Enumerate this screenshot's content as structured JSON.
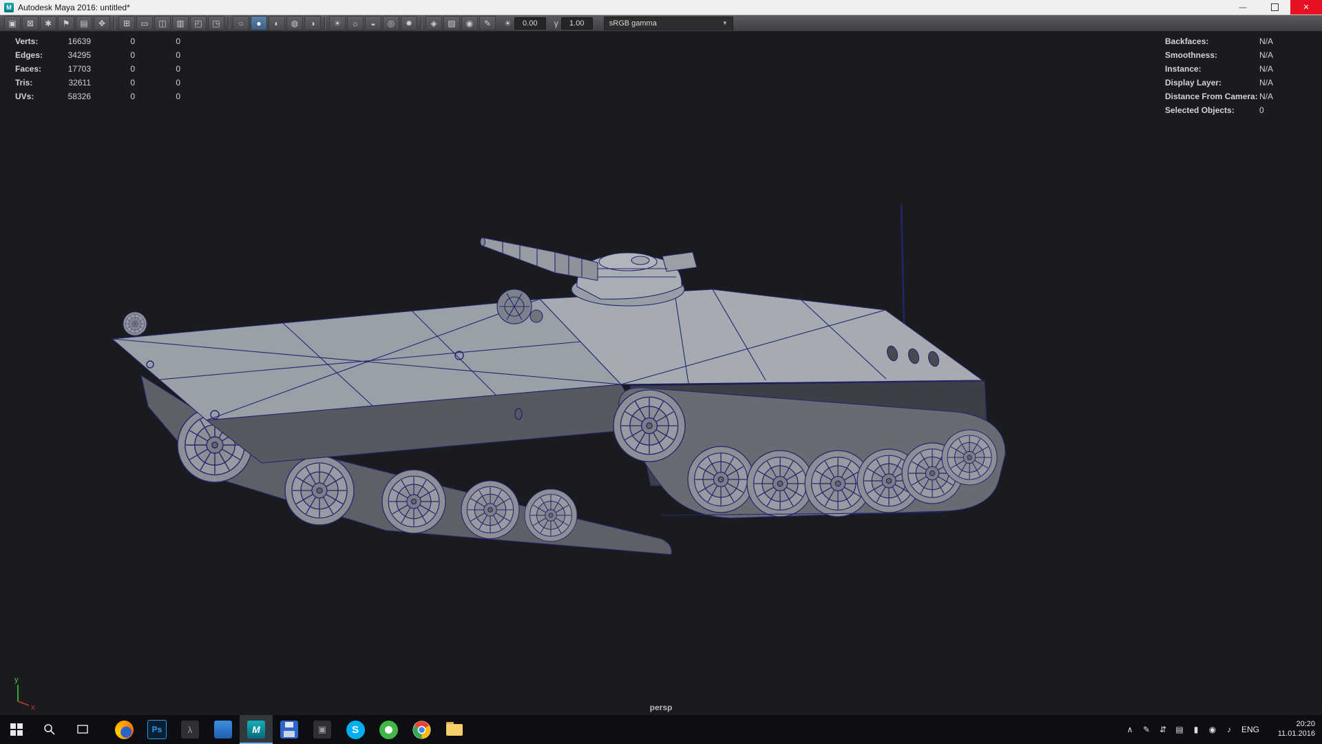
{
  "titlebar": {
    "app_icon_glyph": "M",
    "title": "Autodesk Maya 2016: untitled*",
    "minimize_glyph": "—",
    "close_glyph": "✕"
  },
  "toolbar": {
    "icons": [
      {
        "name": "camera-select",
        "glyph": "▣"
      },
      {
        "name": "camera-lock",
        "glyph": "⊠"
      },
      {
        "name": "camera-attributes",
        "glyph": "✱"
      },
      {
        "name": "bookmark",
        "glyph": "⚑"
      },
      {
        "name": "image-plane",
        "glyph": "▤"
      },
      {
        "name": "pan-zoom",
        "glyph": "✥"
      },
      {
        "name": "grid",
        "glyph": "⊞"
      },
      {
        "name": "film-gate",
        "glyph": "▭"
      },
      {
        "name": "resolution-gate",
        "glyph": "◫"
      },
      {
        "name": "gate-mask",
        "glyph": "▥"
      },
      {
        "name": "field-chart",
        "glyph": "◰"
      },
      {
        "name": "safe-action",
        "glyph": "◳"
      },
      {
        "name": "wireframe",
        "glyph": "○"
      },
      {
        "name": "smooth-shade",
        "glyph": "●"
      },
      {
        "name": "textured",
        "glyph": "◐"
      },
      {
        "name": "use-default-material",
        "glyph": "◍"
      },
      {
        "name": "xray",
        "glyph": "◑"
      },
      {
        "name": "lights",
        "glyph": "☀"
      },
      {
        "name": "shadows",
        "glyph": "☼"
      },
      {
        "name": "ambient-occlusion",
        "glyph": "◒"
      },
      {
        "name": "motion-blur",
        "glyph": "◎"
      },
      {
        "name": "multisample",
        "glyph": "✸"
      },
      {
        "name": "isolate-select",
        "glyph": "◈"
      },
      {
        "name": "fog",
        "glyph": "▨"
      },
      {
        "name": "depth-of-field",
        "glyph": "◉"
      },
      {
        "name": "grease-pencil",
        "glyph": "✎"
      }
    ],
    "exposure_icon": "☀",
    "exposure_value": "0.00",
    "gamma_icon": "γ",
    "gamma_value": "1.00",
    "view_transform": "sRGB gamma",
    "dropdown_arrow": "▼"
  },
  "hud": {
    "left": {
      "rows": [
        {
          "label": "Verts:",
          "c1": "16639",
          "c2": "0",
          "c3": "0"
        },
        {
          "label": "Edges:",
          "c1": "34295",
          "c2": "0",
          "c3": "0"
        },
        {
          "label": "Faces:",
          "c1": "17703",
          "c2": "0",
          "c3": "0"
        },
        {
          "label": "Tris:",
          "c1": "32611",
          "c2": "0",
          "c3": "0"
        },
        {
          "label": "UVs:",
          "c1": "58326",
          "c2": "0",
          "c3": "0"
        }
      ]
    },
    "right": {
      "rows": [
        {
          "label": "Backfaces:",
          "value": "N/A"
        },
        {
          "label": "Smoothness:",
          "value": "N/A"
        },
        {
          "label": "Instance:",
          "value": "N/A"
        },
        {
          "label": "Display Layer:",
          "value": "N/A"
        },
        {
          "label": "Distance From Camera:",
          "value": "N/A"
        },
        {
          "label": "Selected Objects:",
          "value": "0"
        }
      ]
    }
  },
  "viewport": {
    "camera_label": "persp",
    "axis": {
      "x": "x",
      "y": "y"
    }
  },
  "taskbar": {
    "apps": [
      "start",
      "search",
      "task-view",
      "firefox",
      "photoshop",
      "dark-app-1",
      "blue-app",
      "maya",
      "save-app",
      "dark-app-2",
      "skype",
      "green-app",
      "chrome",
      "file-explorer"
    ],
    "active_app": "maya",
    "app_glyphs": {
      "photoshop": "Ps",
      "skype": "S",
      "maya": "M",
      "dark_app_1": "λ",
      "dark_app_2": "▣"
    },
    "tray_icons": [
      {
        "name": "chevron-up",
        "glyph": "∧"
      },
      {
        "name": "pen",
        "glyph": "✎"
      },
      {
        "name": "sync",
        "glyph": "⇵"
      },
      {
        "name": "keyboard",
        "glyph": "▤"
      },
      {
        "name": "battery",
        "glyph": "▮"
      },
      {
        "name": "network",
        "glyph": "◉"
      },
      {
        "name": "volume",
        "glyph": "♪"
      }
    ],
    "language": "ENG",
    "time": "20:20",
    "date": "11.01.2016"
  },
  "colors": {
    "viewport_bg": "#1a1b1e",
    "wireframe": "#25256e",
    "hull_grey": "#9aa0a8",
    "titlebar_bg": "#f0f0f0",
    "toolbar_bg": "#4a4c4f",
    "taskbar_bg": "#0d0e11",
    "close_red": "#e81123",
    "maya_teal": "#0b7f8e",
    "axis_y_green": "#3ad23a",
    "axis_x_red": "#d03636"
  }
}
